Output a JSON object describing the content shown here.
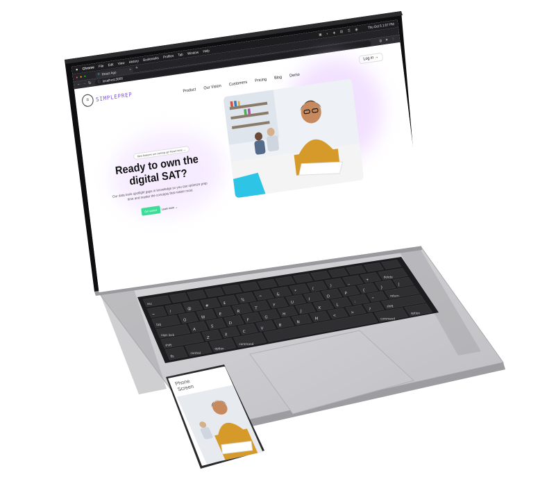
{
  "menubar": {
    "app": "Chrome",
    "items": [
      "File",
      "Edit",
      "View",
      "History",
      "Bookmarks",
      "Profiles",
      "Tab",
      "Window",
      "Help"
    ],
    "clock": "Thu Oct 5  1:07 PM"
  },
  "browser": {
    "tab_title": "React App",
    "new_tab": "+",
    "url": "localhost:3000",
    "login_label": "Log in →"
  },
  "site": {
    "logo_text": "SIMPLEPREP",
    "nav": [
      "Product",
      "Our Vision",
      "Customers",
      "Pricing",
      "Blog",
      "Demo"
    ],
    "announcement": "New features are coming up! Read more →",
    "headline": "Ready to own the digital SAT?",
    "subtext": "Our data tools spotlight gaps in knowledge so you can optimize prep time and master the concepts that matter most.",
    "cta_primary": "Get started",
    "cta_secondary": "Learn more →"
  },
  "keyboard": {
    "row1": [
      "esc"
    ],
    "row2": [
      "~",
      "!",
      "@",
      "#",
      "$",
      "%",
      "^",
      "&",
      "*",
      "(",
      ")",
      "_",
      "+",
      "delete"
    ],
    "row3": [
      "tab",
      "Q",
      "W",
      "E",
      "R",
      "T",
      "Y",
      "U",
      "I",
      "O",
      "P",
      "{",
      "}",
      "|"
    ],
    "row4": [
      "caps lock",
      "A",
      "S",
      "D",
      "F",
      "G",
      "H",
      "J",
      "K",
      "L",
      ":",
      "\"",
      "return"
    ],
    "row5": [
      "shift",
      "Z",
      "X",
      "C",
      "V",
      "B",
      "N",
      "M",
      "<",
      ">",
      "?",
      "shift"
    ],
    "row6": [
      "fn",
      "control",
      "option",
      "command",
      "",
      "command",
      "option"
    ]
  },
  "phone": {
    "caption": "Phone Screen"
  },
  "colors": {
    "brand_purple": "#7c4ddb",
    "cta_green": "#3ddc97",
    "laptop_silver": "#c8c8cc",
    "keycap": "#2c2c2e"
  }
}
